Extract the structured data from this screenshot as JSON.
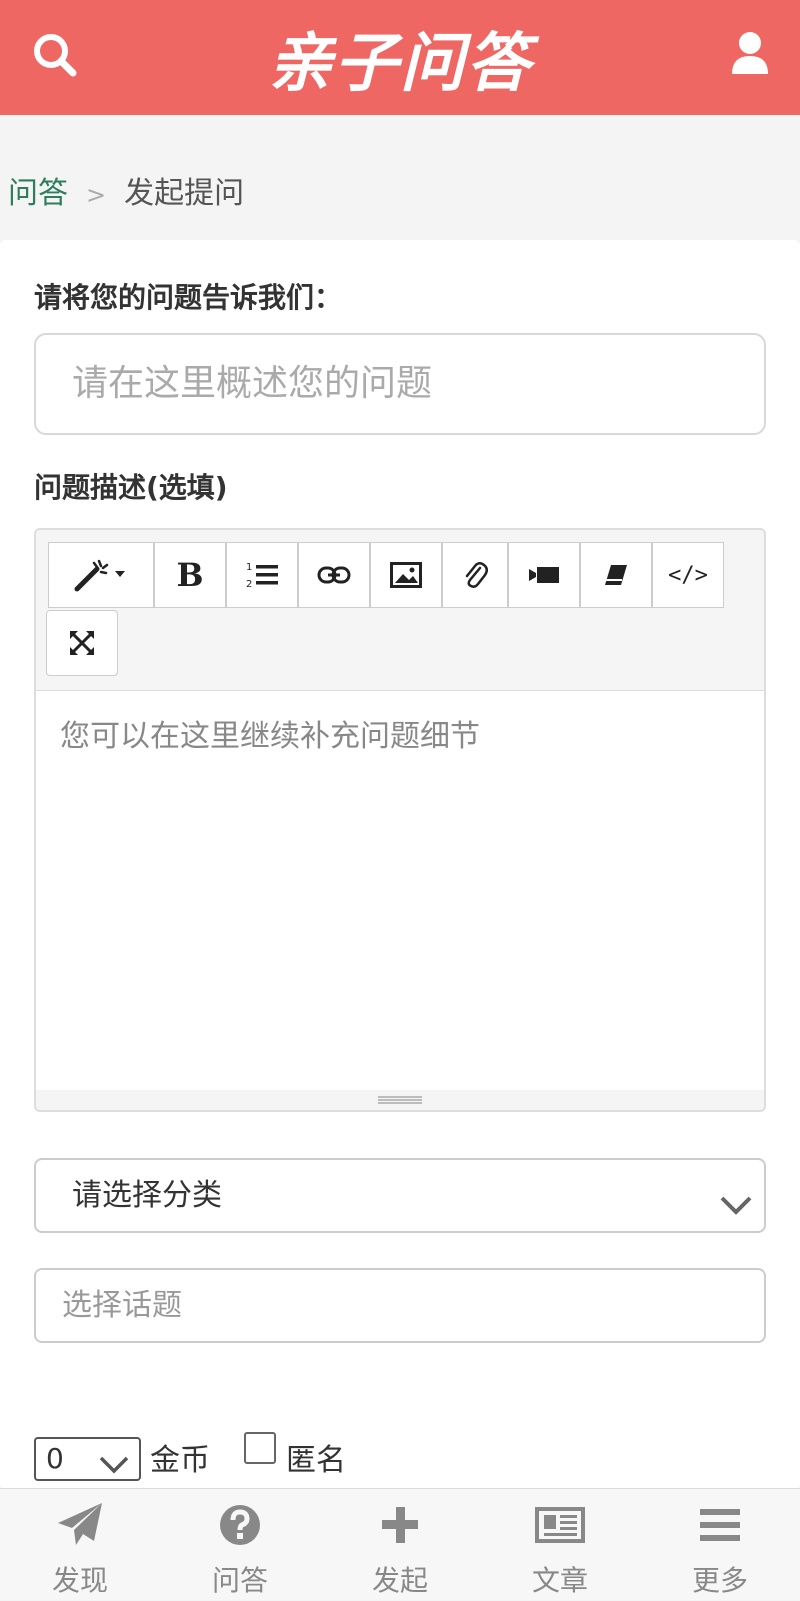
{
  "header": {
    "logo_text": "亲子问答",
    "search_icon": "search-icon",
    "user_icon": "user-icon",
    "bg_color": "#ee6763"
  },
  "breadcrumb": {
    "home": "问答",
    "separator": ">",
    "current": "发起提问"
  },
  "form": {
    "question_label": "请将您的问题告诉我们：",
    "question_placeholder": "请在这里概述您的问题",
    "description_label": "问题描述(选填)",
    "description_placeholder": "您可以在这里继续补充问题细节",
    "toolbar_buttons": [
      {
        "icon": "magic-wand-icon"
      },
      {
        "icon": "bold-icon",
        "label": "B"
      },
      {
        "icon": "ordered-list-icon"
      },
      {
        "icon": "link-icon"
      },
      {
        "icon": "image-icon"
      },
      {
        "icon": "attachment-icon"
      },
      {
        "icon": "video-icon"
      },
      {
        "icon": "eraser-icon"
      },
      {
        "icon": "code-icon",
        "label": "</>"
      },
      {
        "icon": "fullscreen-icon"
      }
    ],
    "category_select": "请选择分类",
    "topic_placeholder": "选择话题",
    "coins_value": "0",
    "coins_label": "金币",
    "anonymous_label": "匿名",
    "anonymous_checked": false
  },
  "bottom_nav": [
    {
      "label": "发现",
      "icon": "paper-plane-icon"
    },
    {
      "label": "问答",
      "icon": "question-circle-icon"
    },
    {
      "label": "发起",
      "icon": "plus-icon"
    },
    {
      "label": "文章",
      "icon": "newspaper-icon"
    },
    {
      "label": "更多",
      "icon": "menu-icon"
    }
  ]
}
